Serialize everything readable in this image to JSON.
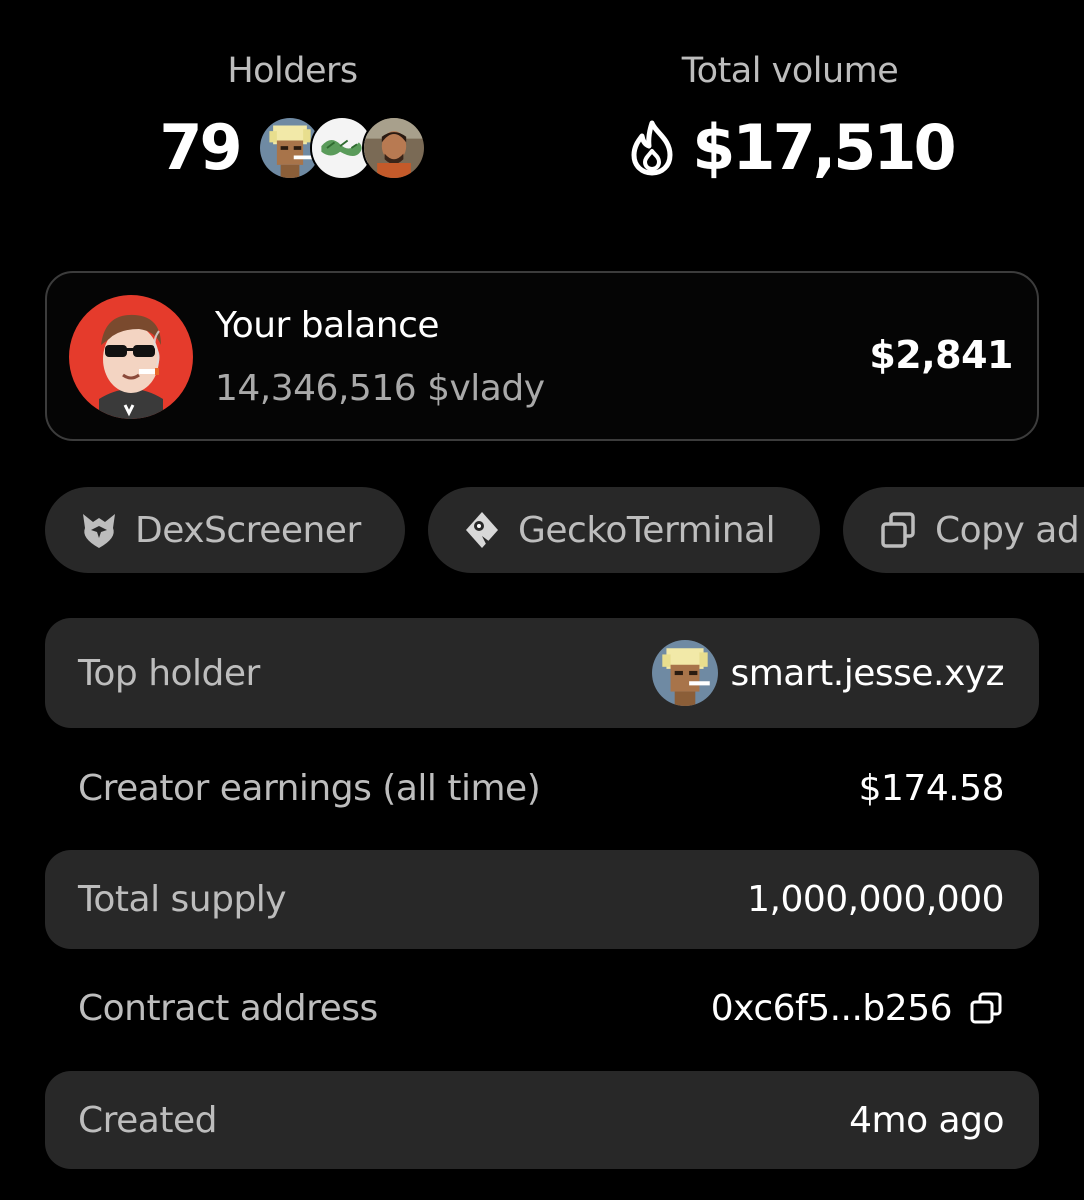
{
  "stats": {
    "holders_label": "Holders",
    "holders_count": "79",
    "volume_label": "Total volume",
    "volume_value": "$17,510"
  },
  "balance": {
    "title": "Your balance",
    "token_amount": "14,346,516 $vlady",
    "usd_value": "$2,841"
  },
  "links": [
    {
      "label": "DexScreener",
      "icon": "dexscreener-icon"
    },
    {
      "label": "GeckoTerminal",
      "icon": "geckoterminal-icon"
    },
    {
      "label": "Copy ad",
      "icon": "copy-icon"
    }
  ],
  "details": {
    "top_holder_label": "Top holder",
    "top_holder_value": "smart.jesse.xyz",
    "creator_earnings_label": "Creator earnings (all time)",
    "creator_earnings_value": "$174.58",
    "total_supply_label": "Total supply",
    "total_supply_value": "1,000,000,000",
    "contract_label": "Contract address",
    "contract_value": "0xc6f5...b256",
    "created_label": "Created",
    "created_value": "4mo ago"
  },
  "colors": {
    "background": "#000000",
    "surface": "#282828",
    "card_border": "#3c3c3c",
    "primary_text": "#ffffff",
    "secondary_text": "#bdbdbd",
    "avatar_red": "#e53b2c"
  }
}
